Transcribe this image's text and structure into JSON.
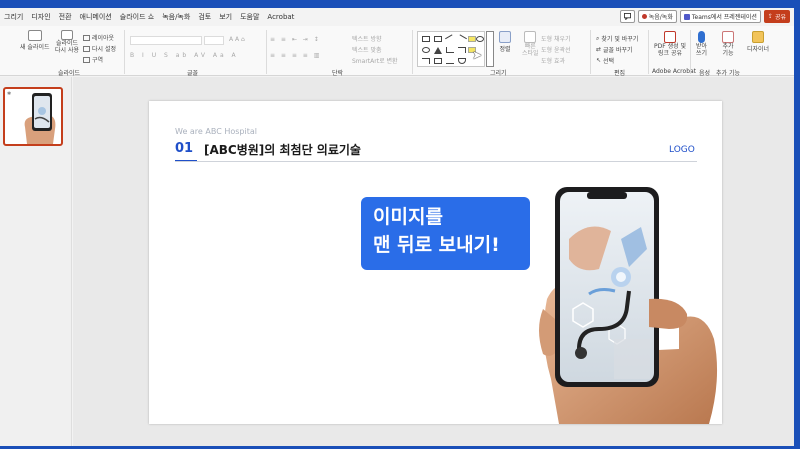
{
  "menubar": {
    "tabs": [
      "그리기",
      "디자인",
      "전환",
      "애니메이션",
      "슬라이드 쇼",
      "녹음/녹화",
      "검토",
      "보기",
      "도움말",
      "Acrobat"
    ],
    "record_label": "녹음/녹화",
    "teams_label": "Teams에서 프레젠테이션",
    "share_label": "공유"
  },
  "ribbon": {
    "new_slide": "새 슬라이드",
    "reuse_slide_1": "슬라이드",
    "reuse_slide_2": "다시 사용",
    "layout": "레이아웃",
    "reset": "다시 설정",
    "section": "구역",
    "text_direction": "텍스트 방향",
    "text_align": "텍스트 맞춤",
    "smartart": "SmartArt로 변환",
    "arrange": "정렬",
    "quick_styles_1": "빠른",
    "quick_styles_2": "스타일",
    "shape_fill": "도형 채우기",
    "shape_outline": "도형 윤곽선",
    "shape_effects": "도형 효과",
    "find_replace": "찾기 및 바꾸기",
    "replace": "글꼴 바꾸기",
    "select": "선택",
    "acrobat_1": "PDF 생성 및",
    "acrobat_2": "링크 공유",
    "dictate_1": "받아",
    "dictate_2": "쓰기",
    "addins_1": "추가",
    "addins_2": "기능",
    "designer": "디자이너",
    "groups": {
      "slides": "슬라이드",
      "font": "글꼴",
      "paragraph": "단락",
      "drawing": "그리기",
      "editing": "편집",
      "adobe": "Adobe Acrobat",
      "voice": "음성",
      "addins": "추가 기능"
    }
  },
  "slide": {
    "kicker": "We are ABC Hospital",
    "number": "01",
    "title": "[ABC병원]의 최첨단 의료기술",
    "logo": "LOGO",
    "callout_line1": "이미지를",
    "callout_line2": "맨 뒤로 보내기!"
  },
  "colors": {
    "accent": "#1f4fc9",
    "callout": "#2a6de8",
    "share": "#c43e1c",
    "page_border": "#1a4fb8"
  }
}
